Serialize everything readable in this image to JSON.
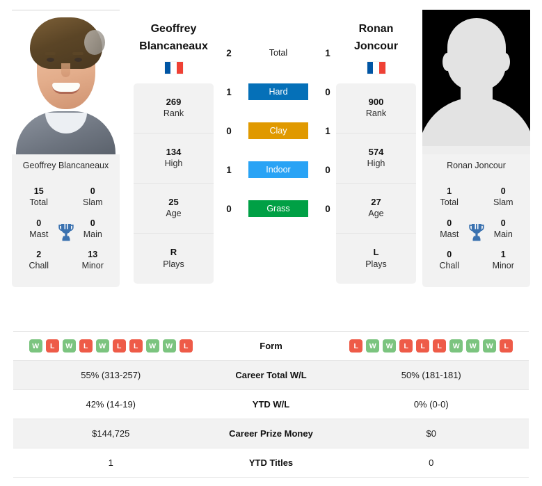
{
  "players": {
    "left": {
      "first_name": "Geoffrey",
      "last_name": "Blancaneaux",
      "display_name": "Geoffrey\nBlancaneaux",
      "photo_caption": "Geoffrey Blancaneaux",
      "country": "France",
      "flag_colors": [
        "#0055A4",
        "#FFFFFF",
        "#EF4135"
      ],
      "photo_type": "player-photo",
      "rank": "269",
      "rank_label": "Rank",
      "high": "134",
      "high_label": "High",
      "age": "25",
      "age_label": "Age",
      "plays": "R",
      "plays_label": "Plays",
      "titles": {
        "total": "15",
        "total_label": "Total",
        "slam": "0",
        "slam_label": "Slam",
        "mast": "0",
        "mast_label": "Mast",
        "main": "0",
        "main_label": "Main",
        "chall": "2",
        "chall_label": "Chall",
        "minor": "13",
        "minor_label": "Minor"
      },
      "form": [
        "W",
        "L",
        "W",
        "L",
        "W",
        "L",
        "L",
        "W",
        "W",
        "L"
      ],
      "career_total_wl": "55% (313-257)",
      "ytd_wl": "42% (14-19)",
      "career_prize_money": "$144,725",
      "ytd_titles": "1"
    },
    "right": {
      "first_name": "Ronan",
      "last_name": "Joncour",
      "display_name": "Ronan\nJoncour",
      "photo_caption": "Ronan Joncour",
      "country": "France",
      "flag_colors": [
        "#0055A4",
        "#FFFFFF",
        "#EF4135"
      ],
      "photo_type": "placeholder-silhouette",
      "rank": "900",
      "rank_label": "Rank",
      "high": "574",
      "high_label": "High",
      "age": "27",
      "age_label": "Age",
      "plays": "L",
      "plays_label": "Plays",
      "titles": {
        "total": "1",
        "total_label": "Total",
        "slam": "0",
        "slam_label": "Slam",
        "mast": "0",
        "mast_label": "Mast",
        "main": "0",
        "main_label": "Main",
        "chall": "0",
        "chall_label": "Chall",
        "minor": "1",
        "minor_label": "Minor"
      },
      "form": [
        "L",
        "W",
        "W",
        "L",
        "L",
        "L",
        "W",
        "W",
        "W",
        "L"
      ],
      "career_total_wl": "50% (181-181)",
      "ytd_wl": "0% (0-0)",
      "career_prize_money": "$0",
      "ytd_titles": "0"
    }
  },
  "head_to_head": [
    {
      "left": "2",
      "label": "Total",
      "right": "1",
      "is_bar": false,
      "color": ""
    },
    {
      "left": "1",
      "label": "Hard",
      "right": "0",
      "is_bar": true,
      "color": "#0570B8"
    },
    {
      "left": "0",
      "label": "Clay",
      "right": "1",
      "is_bar": true,
      "color": "#E09900"
    },
    {
      "left": "1",
      "label": "Indoor",
      "right": "0",
      "is_bar": true,
      "color": "#29A3F5"
    },
    {
      "left": "0",
      "label": "Grass",
      "right": "0",
      "is_bar": true,
      "color": "#00A045"
    }
  ],
  "stats_rows": [
    {
      "label": "Form",
      "left": "",
      "right": "",
      "type": "form",
      "shaded": false
    },
    {
      "label": "Career Total W/L",
      "left": "55% (313-257)",
      "right": "50% (181-181)",
      "type": "text",
      "shaded": true
    },
    {
      "label": "YTD W/L",
      "left": "42% (14-19)",
      "right": "0% (0-0)",
      "type": "text",
      "shaded": false
    },
    {
      "label": "Career Prize Money",
      "left": "$144,725",
      "right": "$0",
      "type": "text",
      "shaded": true
    },
    {
      "label": "YTD Titles",
      "left": "1",
      "right": "0",
      "type": "text",
      "shaded": false
    }
  ],
  "colors": {
    "win_badge": "#7BC47F",
    "loss_badge": "#EE5B48",
    "card_background": "#F2F2F2",
    "trophy": "#3B72B0",
    "hard": "#0570B8",
    "clay": "#E09900",
    "indoor": "#29A3F5",
    "grass": "#00A045"
  }
}
